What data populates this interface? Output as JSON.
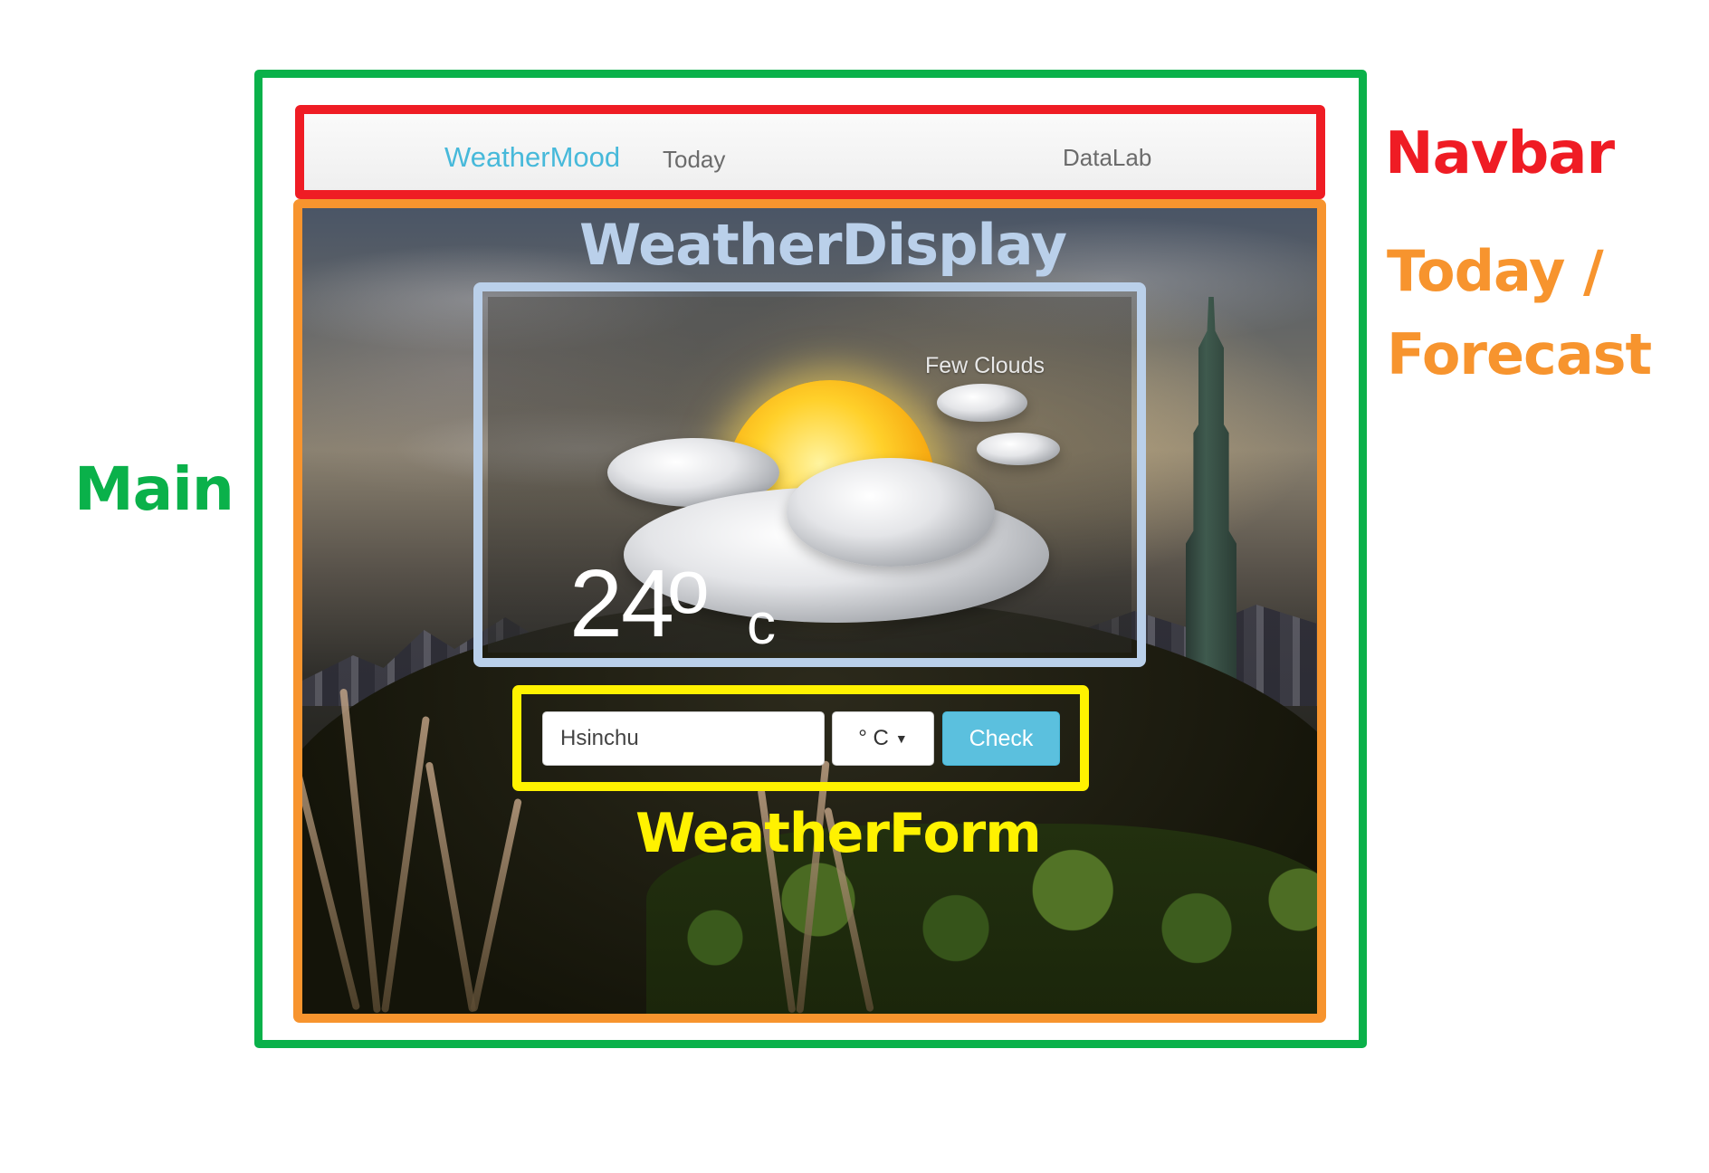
{
  "annotations": {
    "main": "Main",
    "navbar": "Navbar",
    "today": "Today / Forecast",
    "display": "WeatherDisplay",
    "form": "WeatherForm",
    "colors": {
      "main": "#0ab14a",
      "navbar": "#ef1c24",
      "today": "#f7942e",
      "display": "#bad0ea",
      "form": "#fff200"
    }
  },
  "navbar": {
    "brand": "WeatherMood",
    "links": [
      "Today",
      "DataLab"
    ],
    "brand_color": "#47b9da"
  },
  "weather_display": {
    "status": "Few Clouds",
    "temperature": "24",
    "degree_symbol": "o",
    "unit": "c",
    "icon": "sun-behind-clouds-icon"
  },
  "weather_form": {
    "city_value": "Hsinchu",
    "unit_selected": "° C",
    "submit_label": "Check",
    "button_color": "#5bc0de"
  },
  "background": {
    "scene": "city-skyline-icon"
  }
}
